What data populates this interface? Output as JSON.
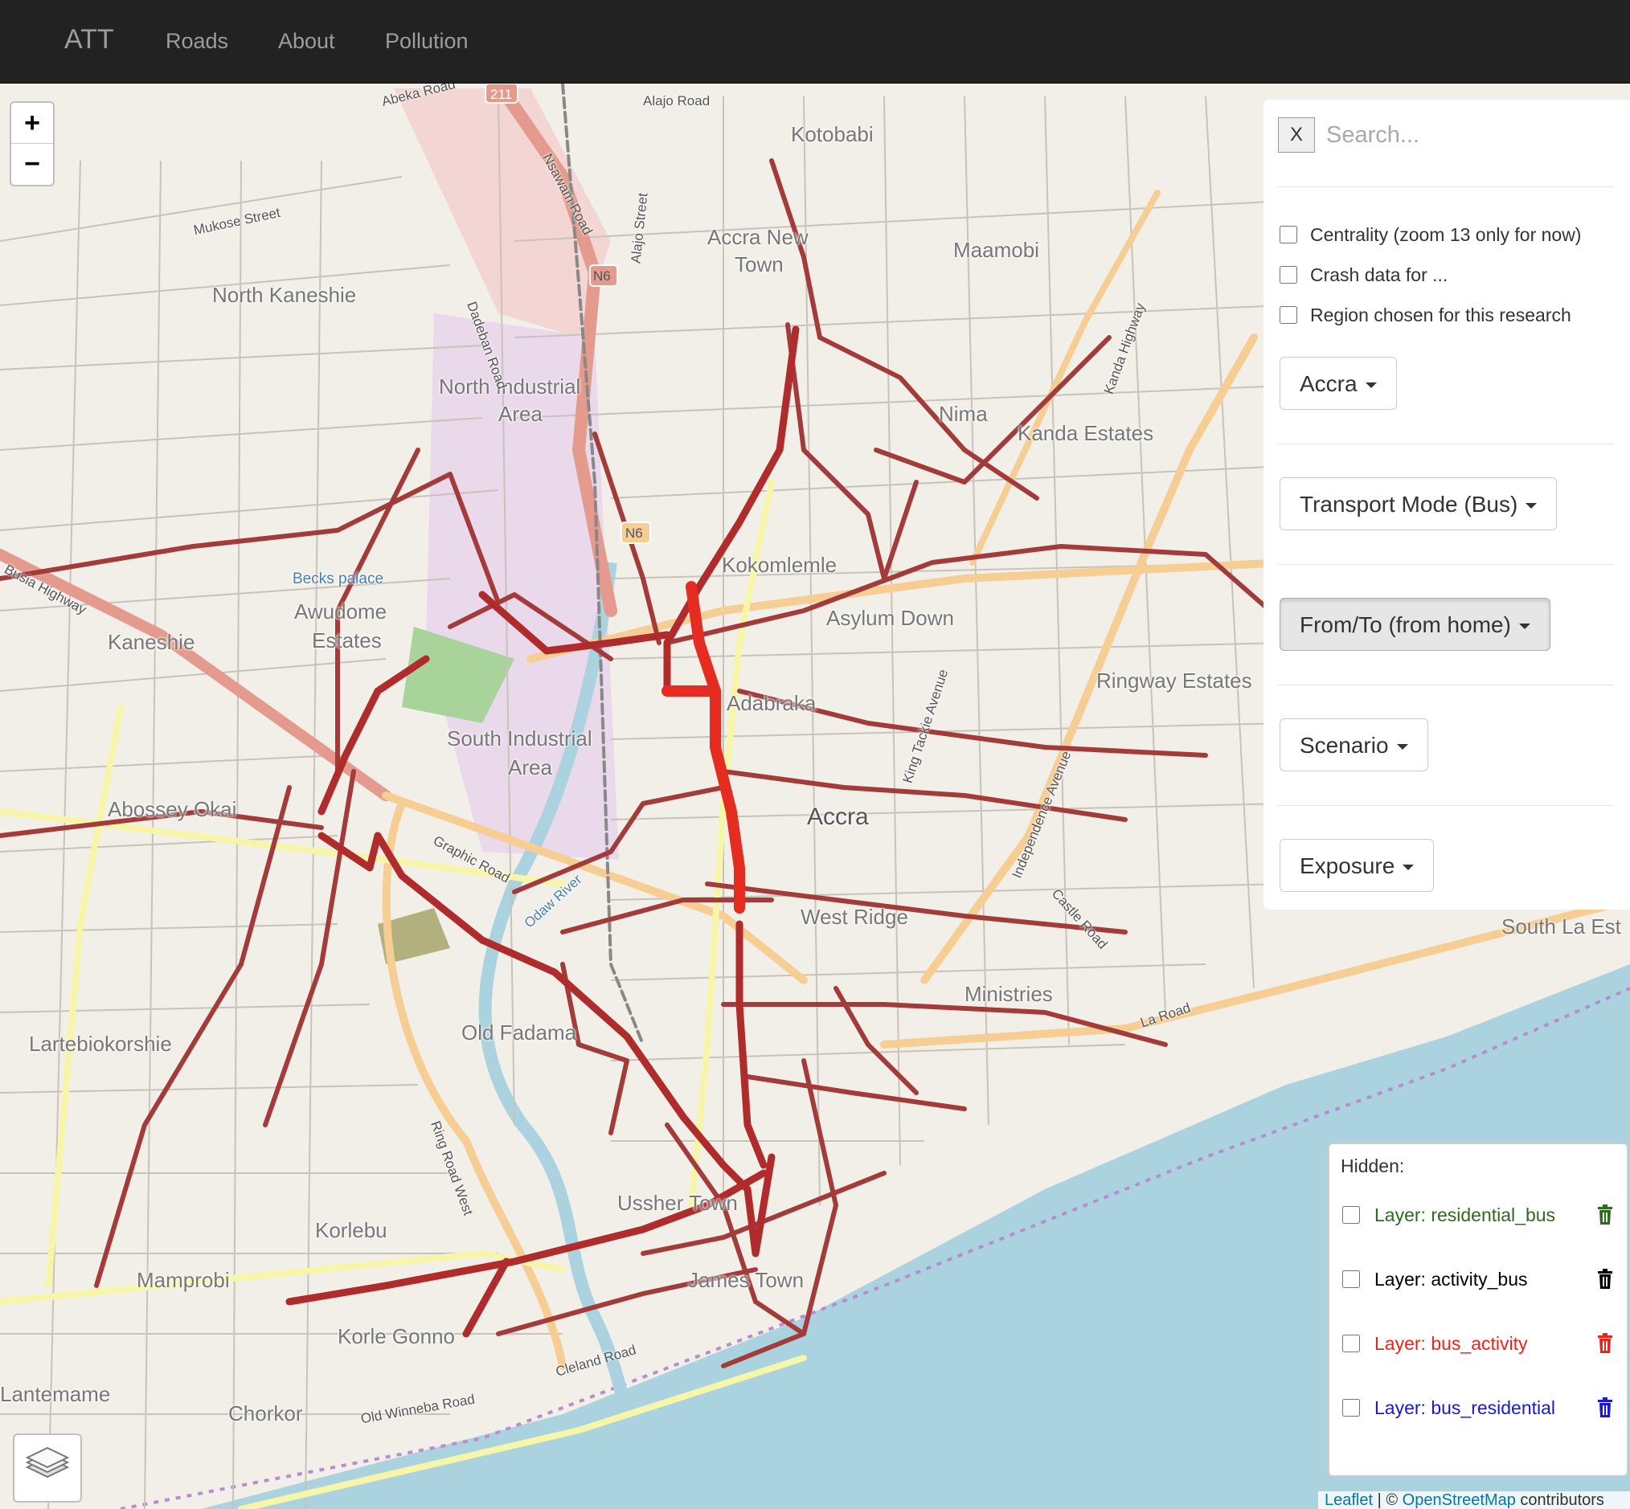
{
  "navbar": {
    "brand": "ATT",
    "links": [
      "Roads",
      "About",
      "Pollution"
    ]
  },
  "map": {
    "zoom_in": "+",
    "zoom_out": "−",
    "places": [
      "Kotobabi",
      "Accra New",
      "Town",
      "Maamobi",
      "North Kaneshie",
      "North Industrial",
      "Area",
      "Nima",
      "Kanda Estates",
      "Kokomlemle",
      "Awudome",
      "Estates",
      "Kaneshie",
      "Asylum Down",
      "Adabraka",
      "Ringway Estates",
      "South Industrial",
      "Area",
      "Abossey Okai",
      "Accra",
      "West Ridge",
      "South La Est",
      "Ministries",
      "Old Fadama",
      "Lartebiokorshie",
      "Korlebu",
      "Mamprobi",
      "Ussher Town",
      "James Town",
      "Korle Gonno",
      "Chorkor",
      "Lantemame"
    ],
    "roads": [
      "Abeka Road",
      "Alajo Road",
      "Mukose Street",
      "Nsawam Road",
      "Alajo Street",
      "Dadeban Road",
      "Busia Highway",
      "Graphic Road",
      "Odaw River",
      "Ring Road West",
      "Kanda Highway",
      "Independence Avenue",
      "King Tackie Avenue",
      "Castle Road",
      "La Road",
      "Cleland Road",
      "Old Winneba Road",
      "Becks palace"
    ],
    "shields": [
      "211",
      "N6",
      "N6"
    ]
  },
  "panel": {
    "close_label": "X",
    "search_placeholder": "Search...",
    "checkboxes": [
      "Centrality (zoom 13 only for now)",
      "Crash data for ...",
      "Region chosen for this research"
    ],
    "dropdowns": [
      "Accra",
      "Transport Mode (Bus)",
      "From/To (from home)",
      "Scenario",
      "Exposure"
    ]
  },
  "legend": {
    "title": "Hidden:",
    "layers": [
      {
        "label": "Layer: residential_bus",
        "color": "#2e6b1e"
      },
      {
        "label": "Layer: activity_bus",
        "color": "#000000"
      },
      {
        "label": "Layer: bus_activity",
        "color": "#e8261e"
      },
      {
        "label": "Layer: bus_residential",
        "color": "#1a1acc"
      }
    ]
  },
  "attribution": {
    "leaflet": "Leaflet",
    "sep": " | © ",
    "osm": "OpenStreetMap",
    "suffix": " contributors"
  },
  "colors": {
    "navbar": "#222222",
    "route_dark": "#a33b3b",
    "route_hot": "#e52c20",
    "sea": "#aad3df"
  }
}
